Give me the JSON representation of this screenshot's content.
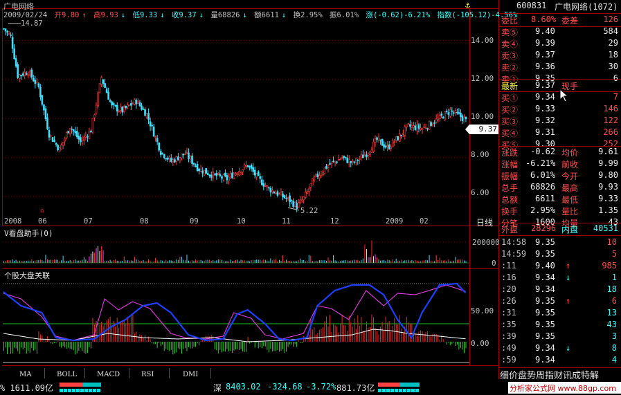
{
  "stock": {
    "title": "广电网络",
    "code": "600831",
    "name_with_count": "广电网络(1072)"
  },
  "info_bar": {
    "date": "2009/02/24",
    "open": "开9.80",
    "high": "高9.93",
    "low": "低9.33",
    "close": "收9.37",
    "volume": "量68826",
    "amount": "额6611",
    "turnover": "换2.95%",
    "amplitude": "振6.01%",
    "change": "涨(-0.62)-6.21%",
    "index": "指数(-105.12)-4.56%"
  },
  "price_chart": {
    "max_label": "14.87",
    "min_label": "5.22",
    "y_ticks": [
      "14.00",
      "12.00",
      "10.00",
      "8.00",
      "6.00"
    ],
    "current_price_tag": "9.37",
    "date_labels": [
      "2008",
      "06",
      "07",
      "08",
      "09",
      "10",
      "11",
      "12",
      "2009",
      "02"
    ],
    "period_label": "日线"
  },
  "volume_panel": {
    "title": "V看盘助手(0)",
    "y_ticks": [
      "200000",
      "0"
    ]
  },
  "indicator_panel": {
    "title": "个股大盘关联",
    "y_ticks": [
      "50.00",
      "0.00"
    ]
  },
  "tabs": [
    "MA",
    "BOLL",
    "MACD",
    "RSI",
    "DMI"
  ],
  "quote": {
    "commission_ratio_label": "委比",
    "commission_ratio": "8.60%",
    "commission_diff_label": "委差",
    "commission_diff": "126",
    "sell": [
      {
        "label": "卖⑤",
        "price": "9.40",
        "vol": "584"
      },
      {
        "label": "卖④",
        "price": "9.39",
        "vol": "29"
      },
      {
        "label": "卖③",
        "price": "9.37",
        "vol": "18"
      },
      {
        "label": "卖②",
        "price": "9.36",
        "vol": "30"
      },
      {
        "label": "卖①",
        "price": "9.35",
        "vol": "6"
      }
    ],
    "last_label": "最新",
    "last": "9.37",
    "last_hand_label": "现手",
    "buy": [
      {
        "label": "买①",
        "price": "9.34",
        "vol": "7"
      },
      {
        "label": "买②",
        "price": "9.33",
        "vol": "146"
      },
      {
        "label": "买③",
        "price": "9.32",
        "vol": "122"
      },
      {
        "label": "买④",
        "price": "9.31",
        "vol": "266"
      },
      {
        "label": "买⑤",
        "price": "9.30",
        "vol": "252"
      }
    ],
    "stats": [
      {
        "l1": "涨跌",
        "v1": "-0.62",
        "l2": "均价",
        "v2": "9.61"
      },
      {
        "l1": "涨幅",
        "v1": "-6.21%",
        "l2": "前收",
        "v2": "9.99"
      },
      {
        "l1": "振幅",
        "v1": "6.01%",
        "l2": "今开",
        "v2": "9.80"
      },
      {
        "l1": "总手",
        "v1": "68826",
        "l2": "最高",
        "v2": "9.93"
      },
      {
        "l1": "总额",
        "v1": "6611",
        "l2": "最低",
        "v2": "9.33"
      },
      {
        "l1": "换手",
        "v1": "2.95%",
        "l2": "量比",
        "v2": "1.35"
      },
      {
        "l1": "分笔",
        "v1": "1600",
        "l2": "均量",
        "v2": "43"
      }
    ],
    "outer_label": "外盘",
    "outer": "28296",
    "inner_label": "内盘",
    "inner": "40531"
  },
  "ticks": [
    {
      "time": "14:58",
      "price": "9.35",
      "arrow": "",
      "vol": "10"
    },
    {
      "time": "14:59",
      "price": "9.35",
      "arrow": "",
      "vol": "5"
    },
    {
      "time": ":11",
      "price": "9.40",
      "arrow": "↑",
      "vol": "985"
    },
    {
      "time": ":16",
      "price": "9.34",
      "arrow": "↓",
      "vol": "1"
    },
    {
      "time": ":20",
      "price": "9.34",
      "arrow": "",
      "vol": "18"
    },
    {
      "time": ":26",
      "price": "9.35",
      "arrow": "↑",
      "vol": "6"
    },
    {
      "time": ":31",
      "price": "9.35",
      "arrow": "",
      "vol": "13"
    },
    {
      "time": ":35",
      "price": "9.35",
      "arrow": "",
      "vol": "43"
    },
    {
      "time": ":39",
      "price": "9.35",
      "arrow": "",
      "vol": "3"
    },
    {
      "time": ":49",
      "price": "9.34",
      "arrow": "↓",
      "vol": "8"
    },
    {
      "time": ":59",
      "price": "9.34",
      "arrow": "",
      "vol": "4"
    }
  ],
  "right_tabs": "细价盘势周指财讯成特解",
  "bottom_bar": {
    "left": "% 1611.09亿",
    "shen_label": "深",
    "shen_value": "8403.02",
    "shen_change": "-324.68",
    "shen_pct": "-3.72%",
    "shen_amount": "881.73亿",
    "watermark": "分析家公式网 www.88gp.com"
  },
  "colors": {
    "up": "#ff5050",
    "down": "#00ffff",
    "border": "#a00000",
    "blue_line": "#2040ff",
    "magenta_line": "#e040e0"
  }
}
